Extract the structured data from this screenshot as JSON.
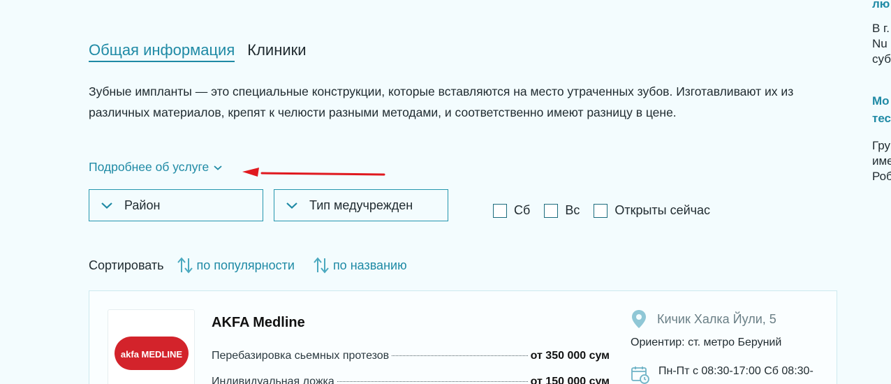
{
  "tabs": [
    {
      "label": "Общая информация",
      "active": true
    },
    {
      "label": "Клиники",
      "active": false
    }
  ],
  "description": "Зубные импланты — это специальные конструкции, которые вставляются на место утраченных зубов. Изготавливают их из различных материалов, крепят к челюсти разными методами, и соответственно имеют разницу в цене.",
  "more_link": "Подробнее об услуге",
  "filters": {
    "district": "Район",
    "institution_type": "Тип медучрежден",
    "checkboxes": [
      {
        "label": "Сб",
        "checked": false
      },
      {
        "label": "Вс",
        "checked": false
      },
      {
        "label": "Открыты сейчас",
        "checked": false
      }
    ]
  },
  "sort": {
    "label": "Сортировать",
    "options": [
      "по популярности",
      "по названию"
    ]
  },
  "clinic": {
    "name": "AKFA Medline",
    "logo_text": "akfa MEDLINE",
    "prices": [
      {
        "service": "Перебазировка сьемных протезов",
        "price": "от 350 000 сум"
      },
      {
        "service": "Индивидуальная ложка",
        "price": "от 150 000 сум"
      }
    ],
    "address": "Кичик Халка Йули, 5",
    "landmark": "Ориентир: ст. метро Беруний",
    "hours": "Пн-Пт с 08:30-17:00 Сб 08:30-"
  },
  "right_column": {
    "heading1": "лю",
    "text1": [
      "В г.",
      "Nu",
      "суб"
    ],
    "heading2": [
      "Мо",
      "тес"
    ],
    "text2": [
      "Гру",
      "име",
      "Роб"
    ]
  },
  "colors": {
    "background": "#f3fcfe",
    "accent": "#1f8aa5",
    "annotation_arrow": "#e0191f",
    "logo_red": "#d3232b"
  }
}
